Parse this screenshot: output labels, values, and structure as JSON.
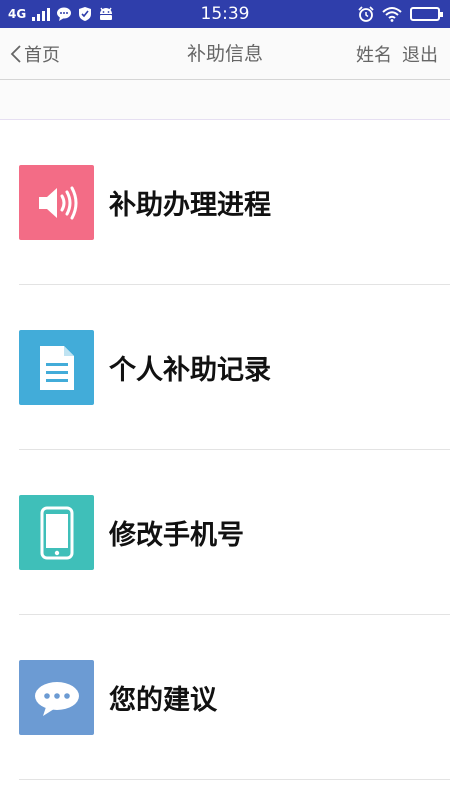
{
  "status_bar": {
    "network": "4G",
    "time": "15:39",
    "background": "#2f3eab"
  },
  "nav": {
    "back_label": "首页",
    "title": "补助信息",
    "user_label": "姓名",
    "logout_label": "退出"
  },
  "menu": {
    "items": [
      {
        "label": "补助办理进程",
        "icon": "speaker-icon",
        "color": "#f36c86"
      },
      {
        "label": "个人补助记录",
        "icon": "document-icon",
        "color": "#42acd9"
      },
      {
        "label": "修改手机号",
        "icon": "phone-icon",
        "color": "#3fbfb9"
      },
      {
        "label": "您的建议",
        "icon": "chat-bubble-icon",
        "color": "#6c9bd3"
      }
    ]
  }
}
